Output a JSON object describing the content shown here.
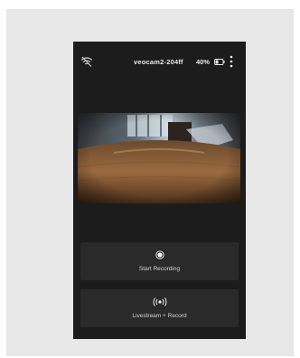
{
  "status_bar": {
    "device_name": "veocam2-204ff",
    "battery_percent": "40%",
    "battery_level": 0.4,
    "icons": [
      "wifi-off-icon",
      "battery-icon",
      "more-vertical-icon"
    ]
  },
  "video": {
    "icon": "camera-preview"
  },
  "actions": {
    "record": {
      "label": "Start Recording",
      "icon": "record-icon"
    },
    "livestream": {
      "label": "Livestream + Record",
      "icon": "broadcast-icon"
    }
  },
  "colors": {
    "background": "#1c1c1c",
    "button": "#2a2a2a",
    "text": "#e8e8e8",
    "frame": "#e7e7e8"
  }
}
